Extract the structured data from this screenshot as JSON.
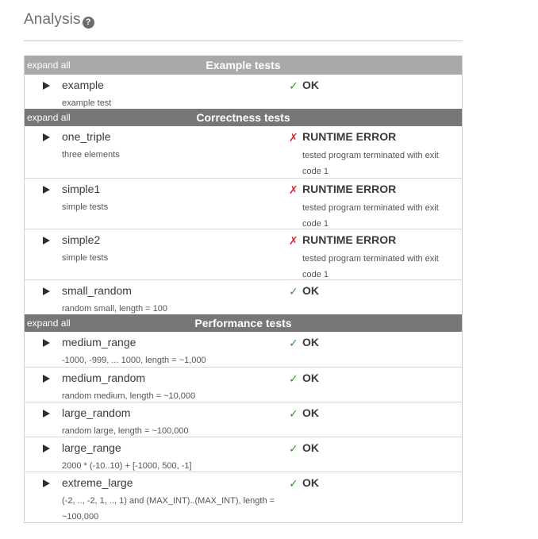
{
  "header": {
    "title": "Analysis",
    "help_glyph": "?"
  },
  "groups": [
    {
      "expand_label": "expand all",
      "title": "Example tests",
      "tests": [
        {
          "name": "example",
          "description": "example test",
          "mark": "✓",
          "status": "OK",
          "detail": ""
        }
      ]
    },
    {
      "expand_label": "expand all",
      "title": "Correctness tests",
      "tests": [
        {
          "name": "one_triple",
          "description": "three elements",
          "mark": "✗",
          "status": "RUNTIME ERROR",
          "detail": "tested program terminated with exit code 1"
        },
        {
          "name": "simple1",
          "description": "simple tests",
          "mark": "✗",
          "status": "RUNTIME ERROR",
          "detail": "tested program terminated with exit code 1"
        },
        {
          "name": "simple2",
          "description": "simple tests",
          "mark": "✗",
          "status": "RUNTIME ERROR",
          "detail": "tested program terminated with exit code 1"
        },
        {
          "name": "small_random",
          "description": "random small, length = 100",
          "mark": "✓",
          "status": "OK",
          "detail": ""
        }
      ]
    },
    {
      "expand_label": "expand all",
      "title": "Performance tests",
      "tests": [
        {
          "name": "medium_range",
          "description": "-1000, -999, ... 1000, length = ~1,000",
          "mark": "✓",
          "status": "OK",
          "detail": ""
        },
        {
          "name": "medium_random",
          "description": "random medium, length = ~10,000",
          "mark": "✓",
          "status": "OK",
          "detail": ""
        },
        {
          "name": "large_random",
          "description": "random large, length = ~100,000",
          "mark": "✓",
          "status": "OK",
          "detail": ""
        },
        {
          "name": "large_range",
          "description": "2000 * (-10..10) + [-1000, 500, -1]",
          "mark": "✓",
          "status": "OK",
          "detail": ""
        },
        {
          "name": "extreme_large",
          "description": "(-2, .., -2, 1, .., 1) and (MAX_INT)..(MAX_INT), length = ~100,000",
          "mark": "✓",
          "status": "OK",
          "detail": ""
        }
      ]
    }
  ],
  "colors": {
    "ok": "#2e9e2e",
    "error": "#d03030",
    "example_header": "#a9a9a9",
    "group_header": "#777777"
  }
}
